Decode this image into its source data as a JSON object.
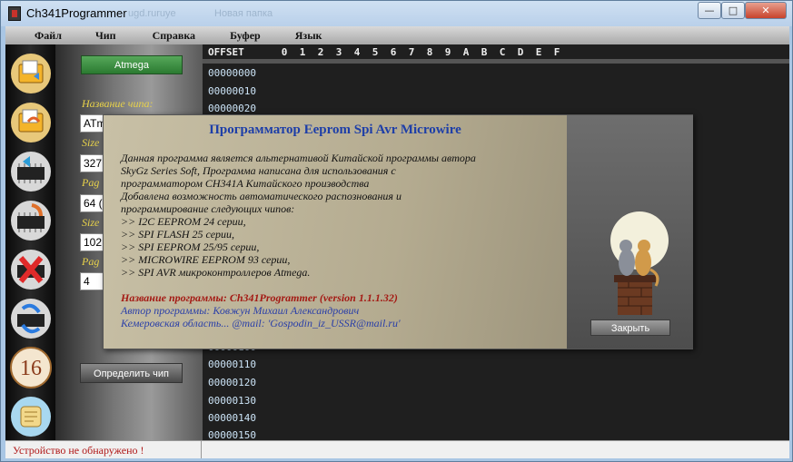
{
  "window": {
    "title": "Ch341Programmer",
    "ghost_text_1": "ugd.ruruye",
    "ghost_text_2": "Новая папка",
    "min_glyph": "—",
    "max_glyph": "□",
    "close_glyph": "✕"
  },
  "menu": [
    "Файл",
    "Чип",
    "Справка",
    "Буфер",
    "Язык"
  ],
  "toolbar": {
    "icons": [
      "open-folder-icon",
      "save-folder-icon",
      "read-chip-icon",
      "write-chip-icon",
      "erase-chip-icon",
      "verify-chip-icon",
      "hex-16-icon",
      "about-scroll-icon"
    ],
    "hex_label": "16"
  },
  "chip_panel": {
    "type_button": "Atmega",
    "name_label": "Название чипа:",
    "name_value": "ATm",
    "size_label": "Size",
    "size_value": "327",
    "page_label": "Pag",
    "page_value": "64 (",
    "size2_label": "Size",
    "size2_value": "102",
    "page2_label": "Pag",
    "page2_value": "4",
    "detect_button": "Определить чип"
  },
  "hex": {
    "offset_label": "OFFSET",
    "columns": [
      "0",
      "1",
      "2",
      "3",
      "4",
      "5",
      "6",
      "7",
      "8",
      "9",
      "A",
      "B",
      "C",
      "D",
      "E",
      "F"
    ],
    "rows": [
      "00000000",
      "00000010",
      "00000020",
      "00000100",
      "00000110",
      "00000120",
      "00000130",
      "00000140",
      "00000150"
    ]
  },
  "status": {
    "text": "Устройство не обнаружено !"
  },
  "about": {
    "title": "Программатор Eeprom Spi Avr Microwire",
    "lines": [
      "Данная программа  является альтернативой Китайской программы автора",
      "SkyGz Series Soft, Программа написана для использования с",
      "программатором CH341A  Китайского производства",
      "Добавлена возможность автоматического распознования и",
      "программирование следующих чипов:",
      ">> I2C EEPROM 24 серии,",
      ">> SPI FLASH 25 серии,",
      ">> SPI EEPROM 25/95 серии,",
      ">> MICROWIRE EEPROM 93 серии,",
      ">> SPI AVR микроконтроллеров Atmega."
    ],
    "program_name": "Название программы:  Ch341Programmer (version 1.1.1.32)",
    "author": "Автор программы:       Ковжун Михаил Александрович",
    "contact": "Кемеровская область...    @mail: 'Gospodin_iz_USSR@mail.ru'",
    "close_button": "Закрыть"
  }
}
